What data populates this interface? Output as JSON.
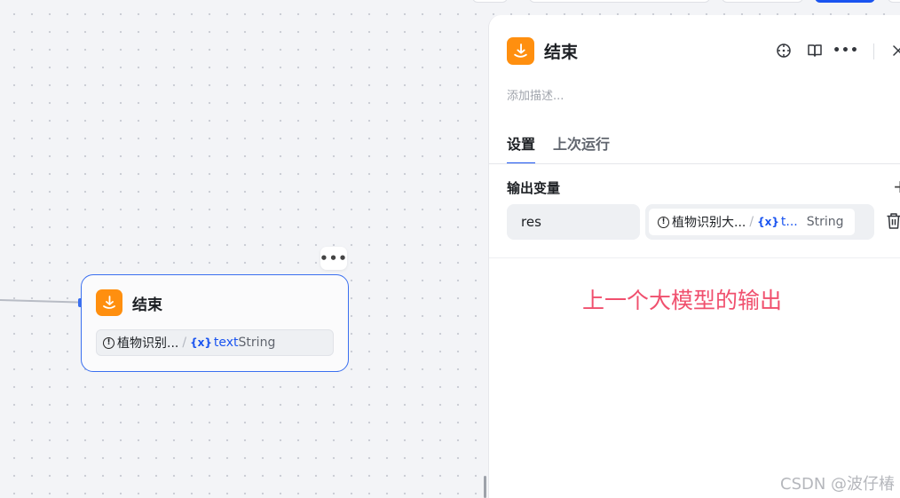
{
  "node": {
    "title": "结束",
    "more_label": "•••",
    "field": {
      "source": "植物识别...",
      "separator": "/",
      "var_icon": "{x}",
      "var_name": "text",
      "var_type": "String"
    }
  },
  "panel": {
    "title": "结束",
    "description_placeholder": "添加描述...",
    "tabs": [
      {
        "label": "设置",
        "active": true
      },
      {
        "label": "上次运行",
        "active": false
      }
    ],
    "output_section": {
      "title": "输出变量",
      "add_label": "+",
      "rows": [
        {
          "name": "res",
          "source": "植物识别大...",
          "separator": "/",
          "var_icon": "{x}",
          "var_name": "t...",
          "var_type": "String"
        }
      ]
    },
    "more_label": "•••"
  },
  "annotation": "上一个大模型的输出",
  "watermark": "CSDN @波仔椿",
  "colors": {
    "accent": "#1a54f0",
    "node_icon": "#ff8f0f",
    "annotation": "#f0506e"
  },
  "icons": {
    "node": "end-node-icon",
    "locate": "crosshair-icon",
    "docs": "book-icon",
    "more": "more-icon",
    "close": "close-icon",
    "delete": "trash-icon",
    "source": "info-circle-icon"
  }
}
